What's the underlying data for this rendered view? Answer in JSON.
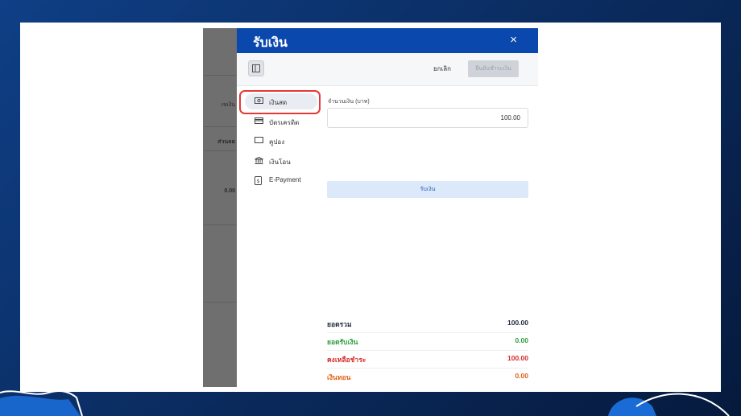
{
  "modal": {
    "title": "รับเงิน",
    "close_glyph": "×",
    "cancel_label": "ยกเลิก",
    "confirm_label": "ยืนยันชำระเงิน"
  },
  "methods": [
    {
      "label": "เงินสด",
      "icon": "cash-icon",
      "active": true
    },
    {
      "label": "บัตรเครดิต",
      "icon": "credit-card-icon",
      "active": false
    },
    {
      "label": "คูปอง",
      "icon": "coupon-icon",
      "active": false
    },
    {
      "label": "เงินโอน",
      "icon": "bank-icon",
      "active": false
    },
    {
      "label": "E-Payment",
      "icon": "epayment-icon",
      "active": false
    }
  ],
  "amount": {
    "label": "จำนวนเงิน (บาท)",
    "value": "100.00"
  },
  "receive_label": "รับเงิน",
  "summary": [
    {
      "label": "ยอดรวม",
      "value": "100.00",
      "color": "#1f2a3d"
    },
    {
      "label": "ยอดรับเงิน",
      "value": "0.00",
      "color": "#2e9e3e"
    },
    {
      "label": "คงเหลือชำระ",
      "value": "100.00",
      "color": "#d62b2b"
    },
    {
      "label": "เงินทอน",
      "value": "0.00",
      "color": "#e0641a"
    }
  ],
  "backdrop": {
    "col_header": "เชเงิน",
    "col_label": "ส่วนลด",
    "col_value": "0.00"
  },
  "colors": {
    "header": "#0a48ad",
    "highlight": "#e53935",
    "background": "#0f3f86"
  }
}
